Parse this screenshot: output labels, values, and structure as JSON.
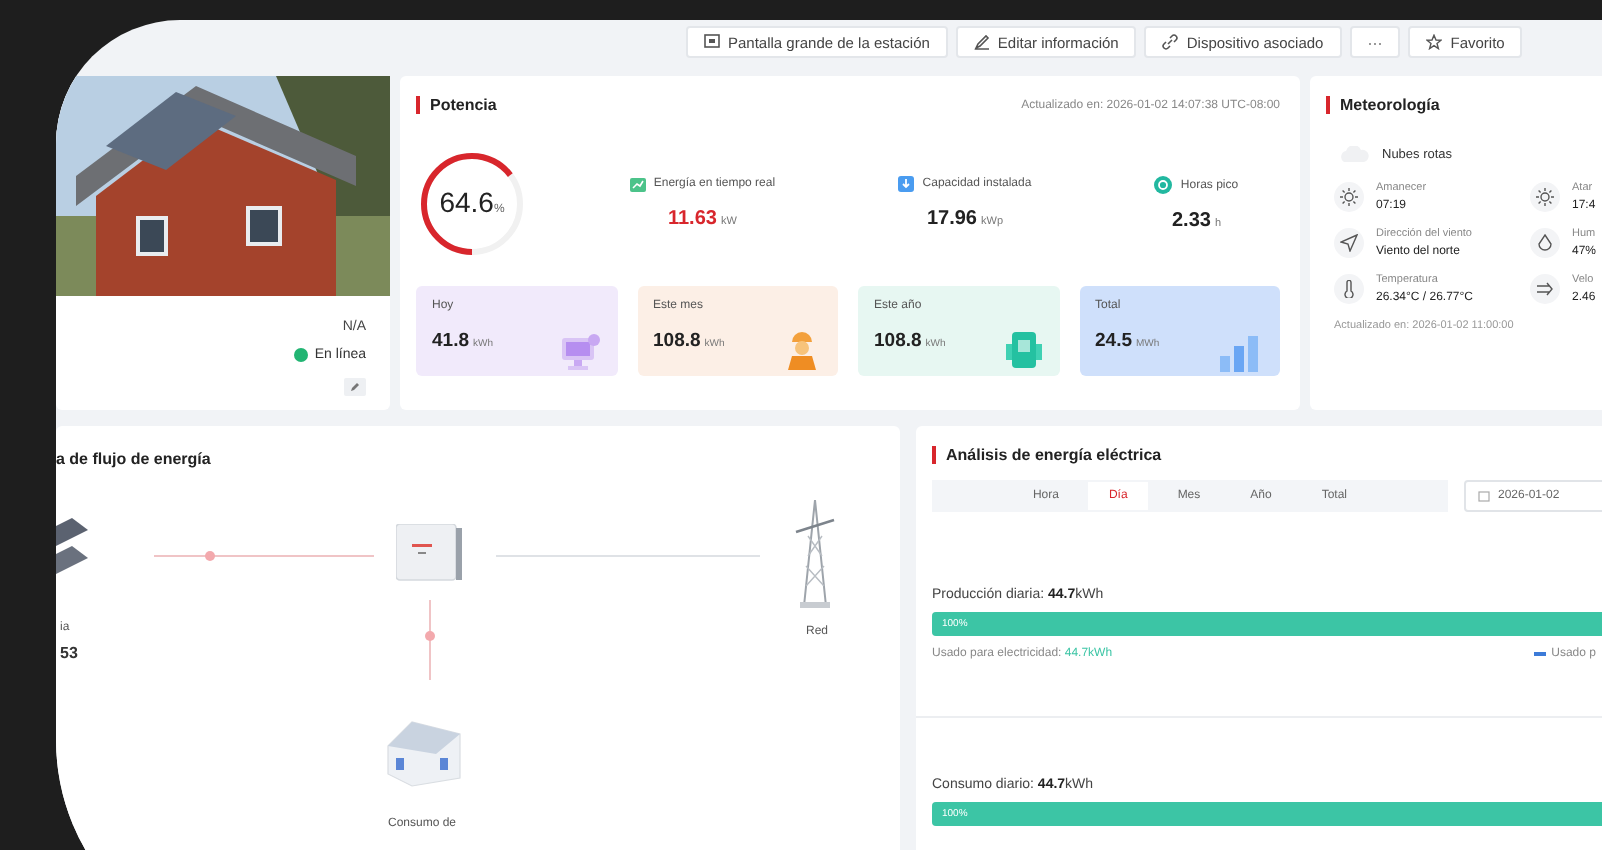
{
  "toolbar": {
    "buttons": [
      {
        "kind": "screen",
        "label": "Pantalla grande de la estación"
      },
      {
        "kind": "edit",
        "label": "Editar información"
      },
      {
        "kind": "link",
        "label": "Dispositivo asociado"
      },
      {
        "kind": "more",
        "label": "···"
      },
      {
        "kind": "star",
        "label": "Favorito"
      }
    ]
  },
  "station": {
    "value": "N/A",
    "status": {
      "label": "En línea",
      "online": true
    }
  },
  "power": {
    "title": "Potencia",
    "updated": "Actualizado en: 2026-01-02 14:07:38 UTC-08:00",
    "gauge": {
      "value": "64.6",
      "unit": "%",
      "level": 0.646
    },
    "metrics": [
      {
        "kind": "realtime",
        "label": "Energía en tiempo real",
        "value": "11.63",
        "unit": "kW",
        "highlight": true
      },
      {
        "kind": "capacity",
        "label": "Capacidad instalada",
        "value": "17.96",
        "unit": "kWp",
        "highlight": false
      },
      {
        "kind": "hours",
        "label": "Horas pico",
        "value": "2.33",
        "unit": "h",
        "highlight": false
      }
    ],
    "tiles": [
      {
        "kind": "today",
        "label": "Hoy",
        "value": "41.8",
        "unit": "kWh"
      },
      {
        "kind": "month",
        "label": "Este mes",
        "value": "108.8",
        "unit": "kWh"
      },
      {
        "kind": "year",
        "label": "Este año",
        "value": "108.8",
        "unit": "kWh"
      },
      {
        "kind": "total",
        "label": "Total",
        "value": "24.5",
        "unit": "MWh"
      }
    ]
  },
  "weather": {
    "title": "Meteorología",
    "condition": "Nubes rotas",
    "items": [
      {
        "kind": "sunrise",
        "label": "Amanecer",
        "value": "07:19"
      },
      {
        "kind": "sunset",
        "label": "Atar",
        "value": "17:4"
      },
      {
        "kind": "wind_direction",
        "label": "Dirección del viento",
        "value": "Viento del norte"
      },
      {
        "kind": "humidity",
        "label": "Hum",
        "value": "47%"
      },
      {
        "kind": "temperature",
        "label": "Temperatura",
        "value": "26.34°C / 26.77°C"
      },
      {
        "kind": "wind_speed",
        "label": "Velo",
        "value": "2.46"
      }
    ],
    "updated": "Actualizado en: 2026-01-02 11:00:00"
  },
  "flow": {
    "title": "a de flujo de energía",
    "nodes": [
      {
        "kind": "solar",
        "label": "ia",
        "value": "53"
      },
      {
        "kind": "inverter"
      },
      {
        "kind": "grid",
        "label": "Red"
      },
      {
        "kind": "load",
        "label": "Consumo de"
      }
    ]
  },
  "analysis": {
    "title": "Análisis de energía eléctrica",
    "tabs": [
      {
        "label": "Hora",
        "selected": false
      },
      {
        "label": "Día",
        "selected": true
      },
      {
        "label": "Mes",
        "selected": false
      },
      {
        "label": "Año",
        "selected": false
      },
      {
        "label": "Total",
        "selected": false
      }
    ],
    "date": "2026-01-02",
    "sections": [
      {
        "heading": "Producción diaria: **44.7**kWh",
        "bar": {
          "label": "100%",
          "level": 1
        },
        "used_label": "Usado para electricidad:",
        "used_value": "44.7kWh",
        "legend": "Usado p"
      },
      {
        "heading": "Consumo diario: **44.7**kWh",
        "bar": {
          "label": "100%",
          "level": 1
        }
      }
    ]
  }
}
